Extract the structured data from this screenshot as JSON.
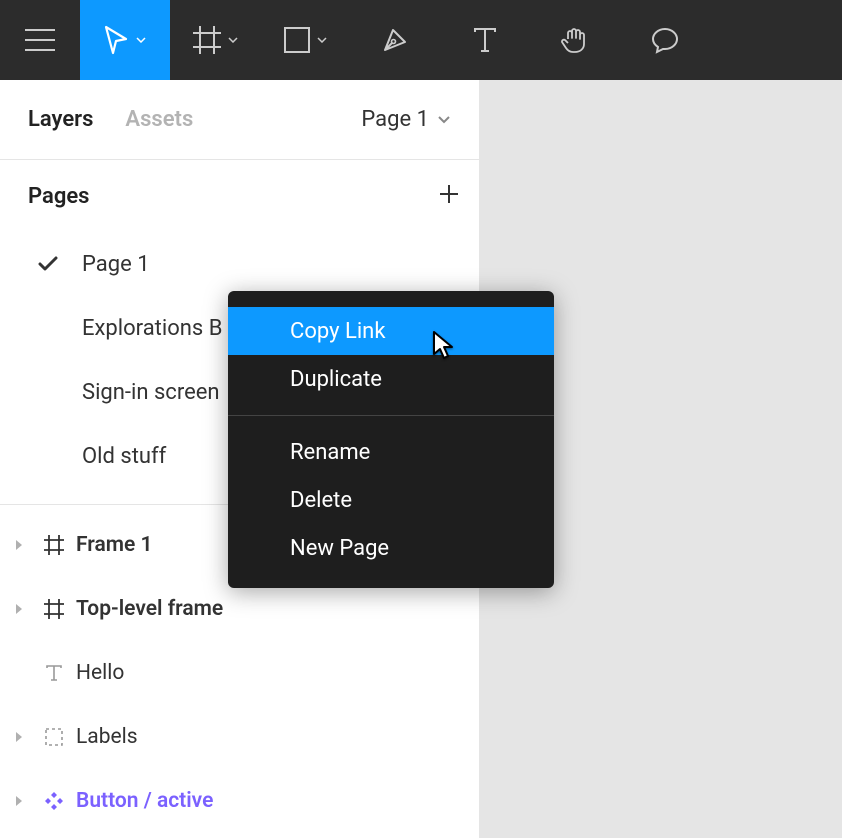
{
  "toolbar": {
    "move_caret": true,
    "frame_caret": true,
    "shape_caret": true
  },
  "panel": {
    "tabs": {
      "layers": "Layers",
      "assets": "Assets"
    },
    "page_selector": "Page 1",
    "pages_header": "Pages",
    "pages": [
      {
        "label": "Page 1",
        "selected": true
      },
      {
        "label": "Explorations B",
        "selected": false
      },
      {
        "label": "Sign-in screen",
        "selected": false
      },
      {
        "label": "Old stuff",
        "selected": false
      }
    ],
    "layers": [
      {
        "label": "Frame 1",
        "kind": "frame",
        "bold": true,
        "expandable": true
      },
      {
        "label": "Top-level frame",
        "kind": "frame",
        "bold": true,
        "expandable": true
      },
      {
        "label": "Hello",
        "kind": "text",
        "bold": false,
        "expandable": false
      },
      {
        "label": "Labels",
        "kind": "group",
        "bold": false,
        "expandable": true
      },
      {
        "label": "Button / active",
        "kind": "component",
        "bold": true,
        "expandable": true
      }
    ]
  },
  "context_menu": {
    "items_a": [
      "Copy Link",
      "Duplicate"
    ],
    "items_b": [
      "Rename",
      "Delete",
      "New Page"
    ],
    "highlight_index": 0
  }
}
